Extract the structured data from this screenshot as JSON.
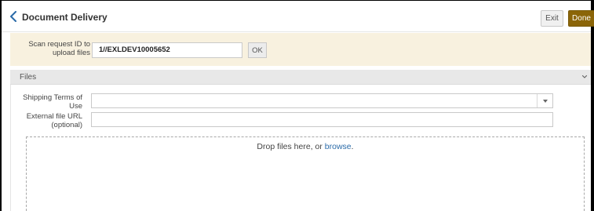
{
  "header": {
    "title": "Document Delivery",
    "exit_label": "Exit",
    "done_label": "Done"
  },
  "scan": {
    "label": "Scan request ID to upload files",
    "value": "1//EXLDEV10005652",
    "ok_label": "OK"
  },
  "files": {
    "title": "Files",
    "shipping_label": "Shipping Terms of Use",
    "shipping_value": "",
    "url_label": "External file URL (optional)",
    "url_value": "",
    "drop_text": "Drop files here, or ",
    "browse_label": "browse",
    "drop_suffix": "."
  },
  "colors": {
    "accent": "#8b6508",
    "scan_panel_bg": "#f8f1df",
    "link": "#2a6aa8"
  },
  "icons": {
    "back": "chevron-left-icon",
    "collapse": "chevron-down-icon",
    "select_caret": "caret-down-icon"
  }
}
